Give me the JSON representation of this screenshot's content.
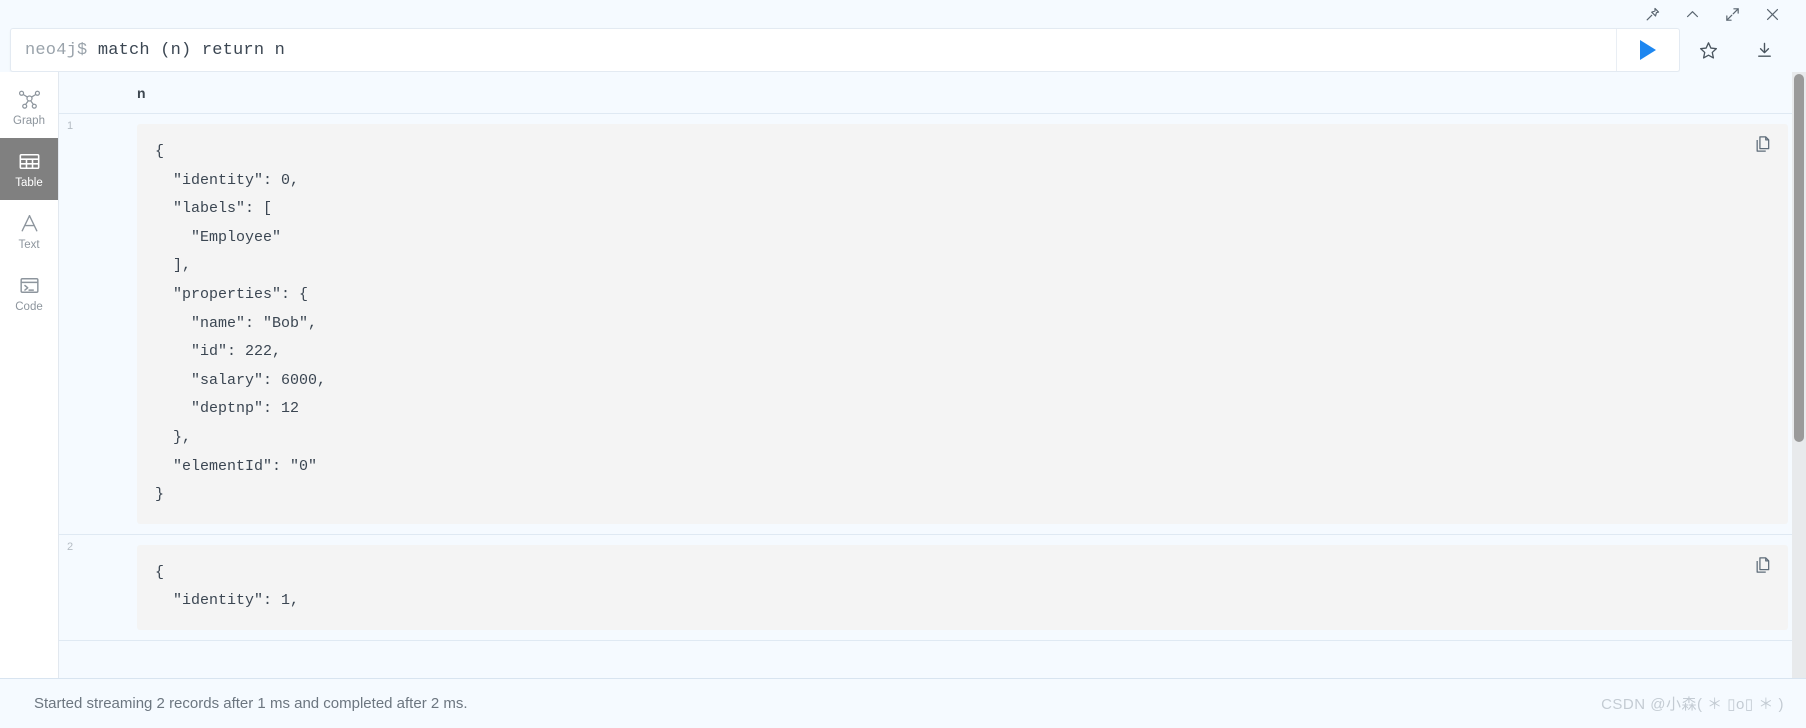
{
  "titlebar": {
    "buttons": [
      {
        "name": "pin-icon",
        "label": "Pin"
      },
      {
        "name": "chevron-up-icon",
        "label": "Collapse"
      },
      {
        "name": "expand-icon",
        "label": "Maximize"
      },
      {
        "name": "close-icon",
        "label": "Close"
      }
    ]
  },
  "editor": {
    "prompt": "neo4j$ ",
    "query": "match (n) return n",
    "run_label": "Run",
    "actions": [
      {
        "name": "favorite-star-icon",
        "label": "Save as favorite"
      },
      {
        "name": "download-icon",
        "label": "Download"
      }
    ]
  },
  "sidebar": {
    "items": [
      {
        "label": "Graph",
        "icon": "graph-icon",
        "active": false
      },
      {
        "label": "Table",
        "icon": "table-icon",
        "active": true
      },
      {
        "label": "Text",
        "icon": "text-icon",
        "active": false
      },
      {
        "label": "Code",
        "icon": "code-icon",
        "active": false
      }
    ]
  },
  "results": {
    "column_header": "n",
    "rows": [
      {
        "number": "1",
        "json": "{\n  \"identity\": 0,\n  \"labels\": [\n    \"Employee\"\n  ],\n  \"properties\": {\n    \"name\": \"Bob\",\n    \"id\": 222,\n    \"salary\": 6000,\n    \"deptnp\": 12\n  },\n  \"elementId\": \"0\"\n}"
      },
      {
        "number": "2",
        "json": "{\n  \"identity\": 1,"
      }
    ],
    "copy_label": "Copy"
  },
  "statusbar": {
    "message": "Started streaming 2 records after 1 ms and completed after 2 ms.",
    "watermark": "CSDN @小森( ＊ ▯o▯ ＊ )"
  }
}
